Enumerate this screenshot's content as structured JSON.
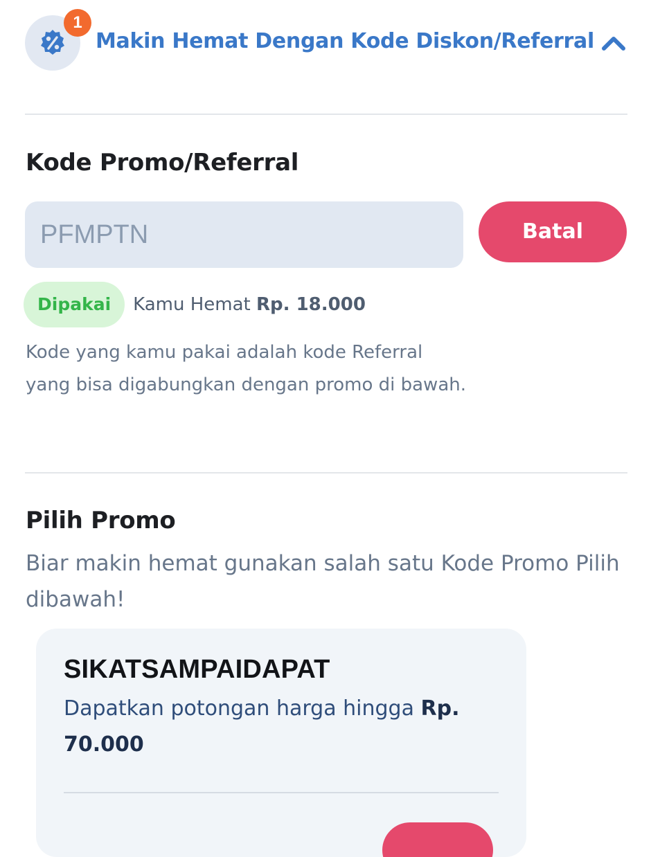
{
  "header": {
    "badge_count": "1",
    "title": "Makin Hemat Dengan Kode Diskon/Referral",
    "discount_icon": "percent-badge-icon",
    "toggle_icon": "chevron-up-icon",
    "accent_color": "#3a78c8",
    "badge_color": "#f26a2e"
  },
  "promo_code_section": {
    "title": "Kode Promo/Referral",
    "input_value": "PFMPTN",
    "cancel_label": "Batal",
    "status_label": "Dipakai",
    "savings_prefix": "Kamu Hemat",
    "savings_amount": "Rp. 18.000",
    "note": "Kode yang kamu pakai adalah kode Referral yang bisa digabungkan dengan promo di bawah."
  },
  "pilih_promo": {
    "title": "Pilih Promo",
    "subtitle": "Biar makin hemat gunakan salah satu Kode Promo Pilih dibawah!",
    "promos": [
      {
        "code": "SIKATSAMPAIDAPAT",
        "description_prefix": "Dapatkan potongan harga hingga",
        "amount": "Rp. 70.000"
      }
    ]
  },
  "colors": {
    "danger_button": "#e5496c",
    "success_pill_bg": "#d8f5d8",
    "success_text": "#34b54a"
  }
}
